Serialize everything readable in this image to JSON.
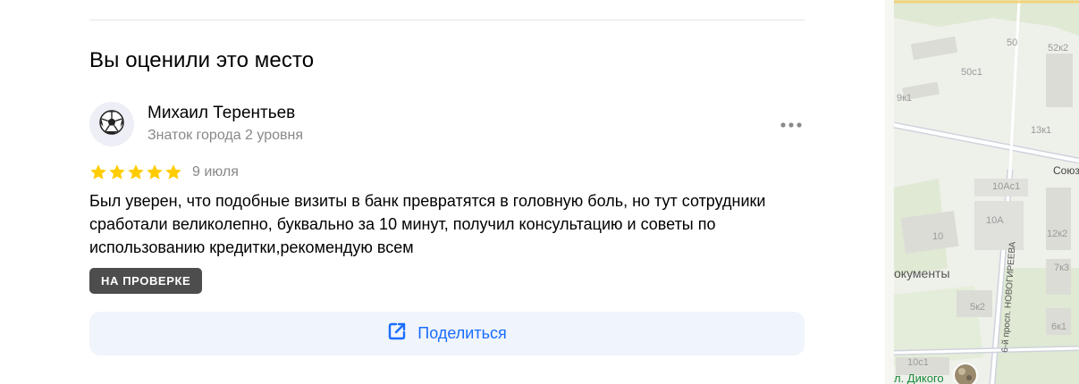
{
  "section": {
    "title": "Вы оценили это место"
  },
  "review": {
    "author_name": "Михаил Терентьев",
    "author_level": "Знаток города 2 уровня",
    "rating": 5,
    "rating_max": 5,
    "date": "9 июля",
    "text": "Был уверен, что подобные визиты в банк превратятся в головную боль, но тут сотрудники сработали великолепно, буквально за 10 минут, получил консультацию и советы по использованию кредитки,рекомендую всем",
    "status": "НА ПРОВЕРКЕ",
    "avatar_icon": "soccer-ball-icon",
    "menu_icon": "more-dots-icon"
  },
  "share": {
    "label": "Поделиться",
    "icon": "share-icon"
  },
  "map": {
    "labels": {
      "l50": "50",
      "l52k2": "52к2",
      "l50c1": "50с1",
      "l9k1": "9к1",
      "l13k1": "13к1",
      "l10ac1": "10Ас1",
      "l10a": "10А",
      "l10": "10",
      "l12k2": "12к2",
      "l7k3": "7к3",
      "l5k2": "5к2",
      "l6k1": "6к1",
      "l10c1": "10с1",
      "street_soyuz": "Союз",
      "street_novogireeva": "6-й просп. НОВОГИРЕЕВА",
      "poi_documents": "окументы",
      "poi_dikogo": "л. Дикого"
    }
  },
  "colors": {
    "accent": "#196dff",
    "star": "#fc0",
    "badge_bg": "#4d4d4d",
    "share_bg": "#f0f4fb",
    "secondary_text": "#888888"
  }
}
